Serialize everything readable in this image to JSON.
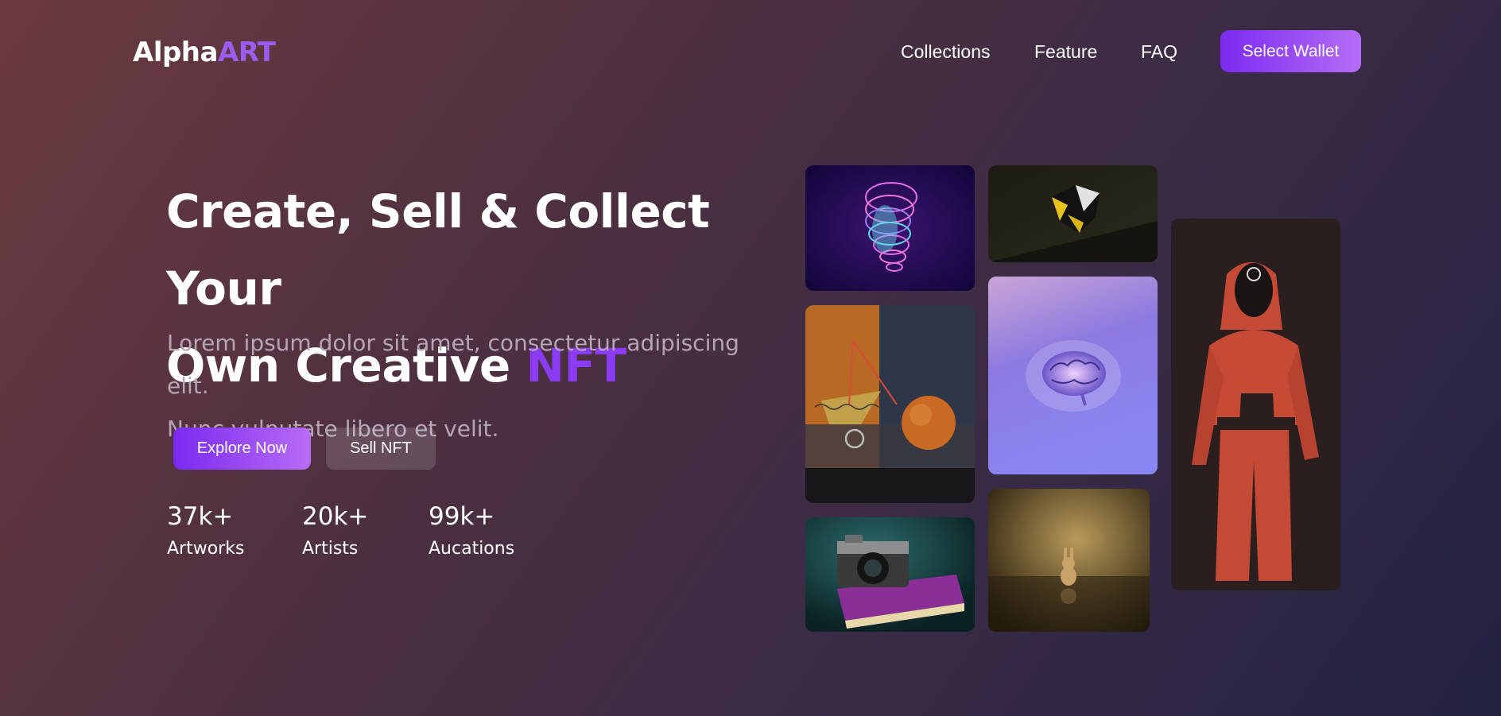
{
  "header": {
    "logo_main": "Alpha",
    "logo_accent": "ART",
    "nav": [
      "Collections",
      "Feature",
      "FAQ"
    ],
    "wallet_button": "Select Wallet"
  },
  "hero": {
    "title_line1": "Create, Sell & Collect Your",
    "title_line2": "Own Creative",
    "title_highlight": "NFT",
    "subtitle_line1": "Lorem ipsum dolor sit amet, consectetur adipiscing elit.",
    "subtitle_line2": "Nunc vulputate libero et velit.",
    "primary_button": "Explore Now",
    "secondary_button": "Sell NFT"
  },
  "stats": [
    {
      "value": "37k+",
      "label": "Artworks"
    },
    {
      "value": "20k+",
      "label": "Artists"
    },
    {
      "value": "99k+",
      "label": "Aucations"
    }
  ],
  "colors": {
    "accent": "#8b3cf2",
    "button_gradient_start": "#7a2aef",
    "button_gradient_end": "#b86cf5"
  },
  "gallery": [
    {
      "name": "holographic-head-image"
    },
    {
      "name": "dark-geometric-crystal-image"
    },
    {
      "name": "orange-still-life-image"
    },
    {
      "name": "glowing-brain-image"
    },
    {
      "name": "red-suit-figure-image"
    },
    {
      "name": "camera-on-book-image"
    },
    {
      "name": "golden-bunny-image"
    }
  ]
}
